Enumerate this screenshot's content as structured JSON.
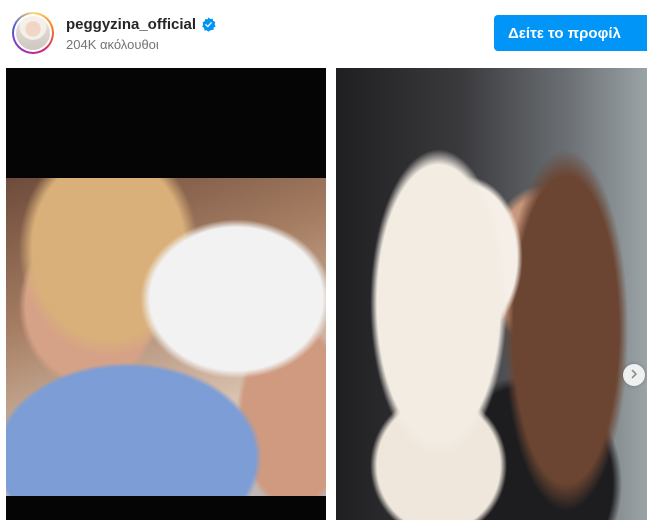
{
  "profile": {
    "username": "peggyzina_official",
    "followers": "204K ακόλουθοι",
    "verified_icon": "verified-badge-icon",
    "view_profile_label": "Δείτε το προφίλ"
  },
  "colors": {
    "button_bg": "#0095f6",
    "verified": "#0095f6",
    "username": "#262626",
    "secondary_text": "#737373"
  },
  "carousel": {
    "slides": [
      {
        "description_icon": "photo-mother-newborn"
      },
      {
        "description_icon": "photo-woman-dog"
      }
    ],
    "next_icon": "chevron-right-icon"
  }
}
